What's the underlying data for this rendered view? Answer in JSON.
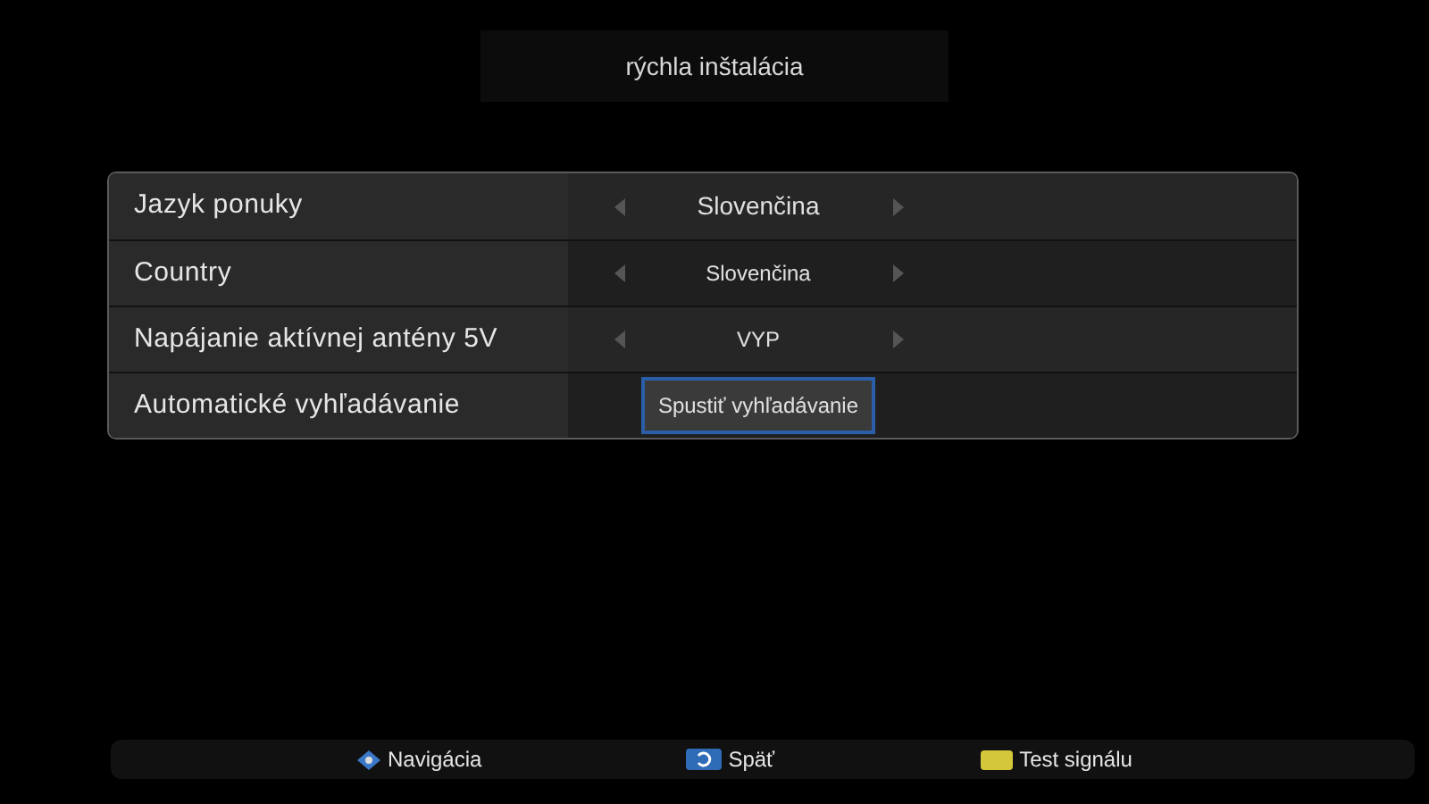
{
  "title": "rýchla inštalácia",
  "rows": [
    {
      "kind": "option",
      "label": "Jazyk ponuky",
      "value": "Slovenčina"
    },
    {
      "kind": "option",
      "label": "Country",
      "value": "Slovenčina"
    },
    {
      "kind": "option",
      "label": "Napájanie aktívnej antény 5V",
      "value": "VYP"
    },
    {
      "kind": "button",
      "label": "Automatické vyhľadávanie",
      "value": "Spustiť vyhľadávanie",
      "focused": true
    }
  ],
  "hints": [
    {
      "kind": "dpad",
      "label": "Navigácia"
    },
    {
      "kind": "back",
      "label": "Späť"
    },
    {
      "kind": "yellow",
      "label": "Test signálu"
    }
  ]
}
